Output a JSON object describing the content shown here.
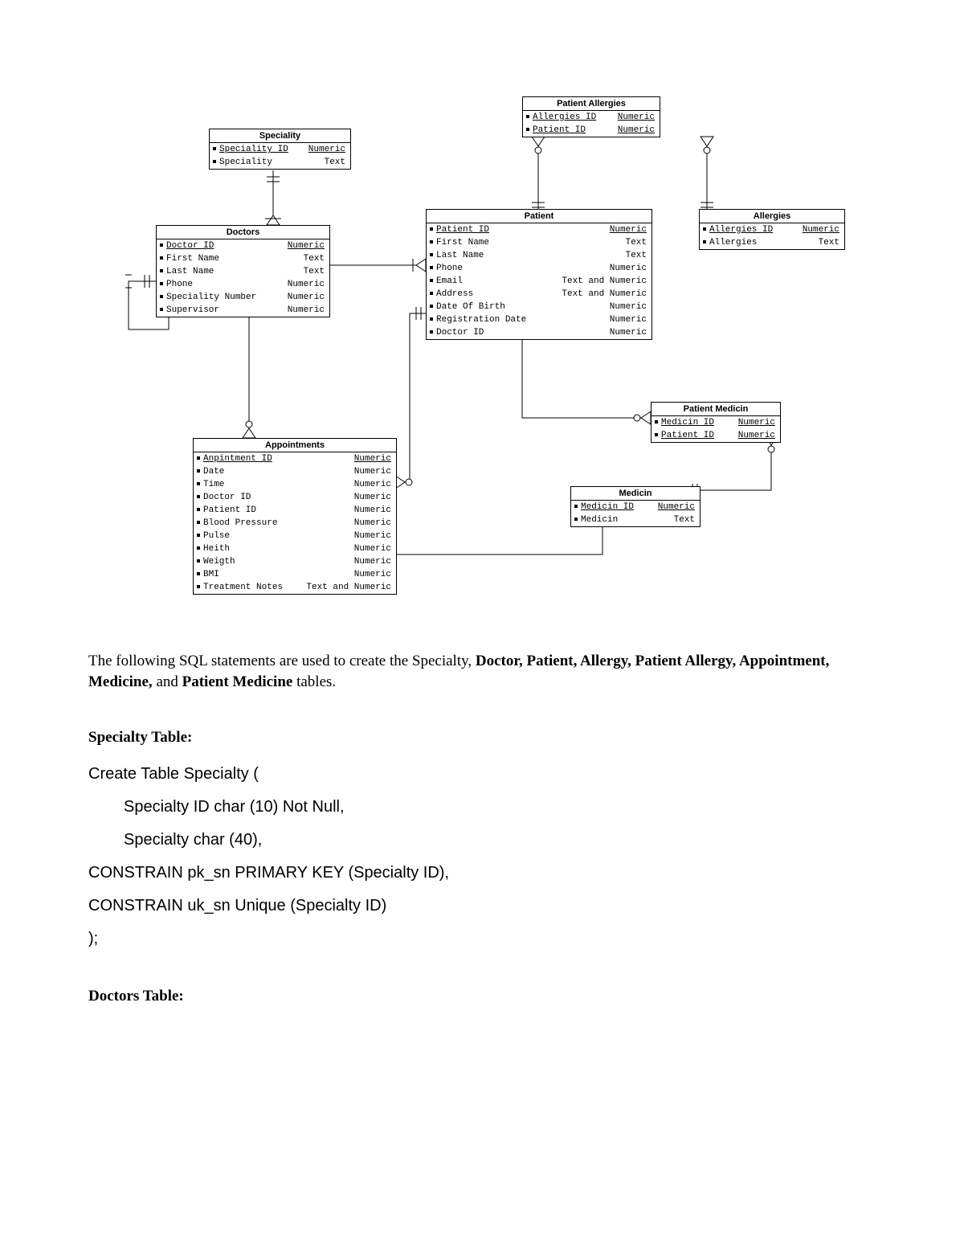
{
  "diagram": {
    "entities": {
      "speciality": {
        "title": "Speciality",
        "attrs": [
          {
            "name": "Speciality ID",
            "type": "Numeric",
            "key": true
          },
          {
            "name": "Speciality",
            "type": "Text",
            "key": false
          }
        ]
      },
      "doctors": {
        "title": "Doctors",
        "attrs": [
          {
            "name": "Doctor ID",
            "type": "Numeric",
            "key": true
          },
          {
            "name": "First Name",
            "type": "Text",
            "key": false
          },
          {
            "name": "Last Name",
            "type": "Text",
            "key": false
          },
          {
            "name": "Phone",
            "type": "Numeric",
            "key": false
          },
          {
            "name": "Speciality Number",
            "type": "Numeric",
            "key": false
          },
          {
            "name": "Supervisor",
            "type": "Numeric",
            "key": false
          }
        ]
      },
      "patient": {
        "title": "Patient",
        "attrs": [
          {
            "name": "Patient ID",
            "type": "Numeric",
            "key": true
          },
          {
            "name": "First Name",
            "type": "Text",
            "key": false
          },
          {
            "name": "Last Name",
            "type": "Text",
            "key": false
          },
          {
            "name": "Phone",
            "type": "Numeric",
            "key": false
          },
          {
            "name": "Email",
            "type": "Text and Numeric",
            "key": false
          },
          {
            "name": "Address",
            "type": "Text and Numeric",
            "key": false
          },
          {
            "name": "Date Of Birth",
            "type": "Numeric",
            "key": false
          },
          {
            "name": "Registration Date",
            "type": "Numeric",
            "key": false
          },
          {
            "name": "Doctor ID",
            "type": "Numeric",
            "key": false
          }
        ]
      },
      "patient_allergies": {
        "title": "Patient Allergies",
        "attrs": [
          {
            "name": "Allergies ID",
            "type": "Numeric",
            "key": true
          },
          {
            "name": "Patient ID",
            "type": "Numeric",
            "key": true
          }
        ]
      },
      "allergies": {
        "title": "Allergies",
        "attrs": [
          {
            "name": "Allergies ID",
            "type": "Numeric",
            "key": true
          },
          {
            "name": "Allergies",
            "type": "Text",
            "key": false
          }
        ]
      },
      "patient_medicin": {
        "title": "Patient Medicin",
        "attrs": [
          {
            "name": "Medicin ID",
            "type": "Numeric",
            "key": true
          },
          {
            "name": "Patient ID",
            "type": "Numeric",
            "key": true
          }
        ]
      },
      "medicin": {
        "title": "Medicin",
        "attrs": [
          {
            "name": "Medicin ID",
            "type": "Numeric",
            "key": true
          },
          {
            "name": "Medicin",
            "type": "Text",
            "key": false
          }
        ]
      },
      "appointments": {
        "title": "Appointments",
        "attrs": [
          {
            "name": "Anpintment ID",
            "type": "Numeric",
            "key": true
          },
          {
            "name": "Date",
            "type": "Numeric",
            "key": false
          },
          {
            "name": "Time",
            "type": "Numeric",
            "key": false
          },
          {
            "name": "Doctor ID",
            "type": "Numeric",
            "key": false
          },
          {
            "name": "Patient ID",
            "type": "Numeric",
            "key": false
          },
          {
            "name": "Blood Pressure",
            "type": "Numeric",
            "key": false
          },
          {
            "name": "Pulse",
            "type": "Numeric",
            "key": false
          },
          {
            "name": "Heith",
            "type": "Numeric",
            "key": false
          },
          {
            "name": "Weigth",
            "type": "Numeric",
            "key": false
          },
          {
            "name": "BMI",
            "type": "Numeric",
            "key": false
          },
          {
            "name": "Treatment Notes",
            "type": "Text and Numeric",
            "key": false
          }
        ]
      }
    }
  },
  "paragraph": {
    "lead": "The following SQL statements are used to create the Specialty, ",
    "bold1": "Doctor, Patient, Allergy, Patient Allergy, Appointment, Medicine,",
    "mid": " and ",
    "bold2": "Patient Medicine",
    "tail": " tables."
  },
  "sections": {
    "specialty": {
      "heading": "Specialty Table:",
      "lines": [
        "Create Table Specialty (",
        "Specialty ID char (10) Not Null,",
        "Specialty char (40),",
        "CONSTRAIN pk_sn PRIMARY KEY (Specialty ID),",
        "CONSTRAIN uk_sn Unique (Specialty ID)",
        ");"
      ],
      "indent": [
        false,
        true,
        true,
        false,
        false,
        false
      ]
    },
    "doctors": {
      "heading": "Doctors Table:"
    }
  }
}
